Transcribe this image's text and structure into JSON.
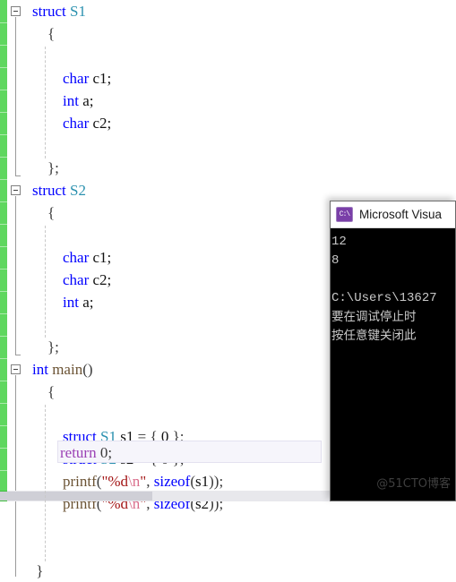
{
  "editor": {
    "change_bar_color": "#5fd75f",
    "current_line_highlight": "#f6f5fb",
    "colors": {
      "keyword": "#0000ff",
      "user_type": "#2b91af",
      "string": "#a31515",
      "escape": "#d96c8a",
      "return_keyword": "#9b41b5",
      "function": "#6b5334"
    },
    "lines": [
      {
        "fold": true,
        "indent": 0,
        "tokens": [
          {
            "t": "keyword",
            "v": "struct"
          },
          {
            "t": "plain",
            "v": " "
          },
          {
            "t": "type",
            "v": "S1"
          }
        ]
      },
      {
        "fold": false,
        "indent": 1,
        "tokens": [
          {
            "t": "pun",
            "v": "{"
          }
        ]
      },
      {
        "fold": false,
        "indent": 2,
        "tokens": []
      },
      {
        "fold": false,
        "indent": 2,
        "tokens": [
          {
            "t": "keyword",
            "v": "char"
          },
          {
            "t": "plain",
            "v": " "
          },
          {
            "t": "id",
            "v": "c1;"
          }
        ]
      },
      {
        "fold": false,
        "indent": 2,
        "tokens": [
          {
            "t": "keyword",
            "v": "int"
          },
          {
            "t": "plain",
            "v": " "
          },
          {
            "t": "id",
            "v": "a;"
          }
        ]
      },
      {
        "fold": false,
        "indent": 2,
        "tokens": [
          {
            "t": "keyword",
            "v": "char"
          },
          {
            "t": "plain",
            "v": " "
          },
          {
            "t": "id",
            "v": "c2;"
          }
        ]
      },
      {
        "fold": false,
        "indent": 2,
        "tokens": []
      },
      {
        "fold": false,
        "indent": 1,
        "tokens": [
          {
            "t": "pun",
            "v": "};"
          }
        ]
      },
      {
        "fold": true,
        "indent": 0,
        "tokens": [
          {
            "t": "keyword",
            "v": "struct"
          },
          {
            "t": "plain",
            "v": " "
          },
          {
            "t": "type",
            "v": "S2"
          }
        ]
      },
      {
        "fold": false,
        "indent": 1,
        "tokens": [
          {
            "t": "pun",
            "v": "{"
          }
        ]
      },
      {
        "fold": false,
        "indent": 2,
        "tokens": []
      },
      {
        "fold": false,
        "indent": 2,
        "tokens": [
          {
            "t": "keyword",
            "v": "char"
          },
          {
            "t": "plain",
            "v": " "
          },
          {
            "t": "id",
            "v": "c1;"
          }
        ]
      },
      {
        "fold": false,
        "indent": 2,
        "tokens": [
          {
            "t": "keyword",
            "v": "char"
          },
          {
            "t": "plain",
            "v": " "
          },
          {
            "t": "id",
            "v": "c2;"
          }
        ]
      },
      {
        "fold": false,
        "indent": 2,
        "tokens": [
          {
            "t": "keyword",
            "v": "int"
          },
          {
            "t": "plain",
            "v": " "
          },
          {
            "t": "id",
            "v": "a;"
          }
        ]
      },
      {
        "fold": false,
        "indent": 2,
        "tokens": []
      },
      {
        "fold": false,
        "indent": 1,
        "tokens": [
          {
            "t": "pun",
            "v": "};"
          }
        ]
      },
      {
        "fold": true,
        "indent": 0,
        "tokens": [
          {
            "t": "keyword",
            "v": "int"
          },
          {
            "t": "plain",
            "v": " "
          },
          {
            "t": "fn",
            "v": "main"
          },
          {
            "t": "pun",
            "v": "()"
          }
        ]
      },
      {
        "fold": false,
        "indent": 1,
        "tokens": [
          {
            "t": "pun",
            "v": "{"
          }
        ]
      },
      {
        "fold": false,
        "indent": 2,
        "tokens": []
      },
      {
        "fold": false,
        "indent": 2,
        "tokens": [
          {
            "t": "keyword",
            "v": "struct"
          },
          {
            "t": "plain",
            "v": " "
          },
          {
            "t": "type",
            "v": "S1"
          },
          {
            "t": "plain",
            "v": " "
          },
          {
            "t": "id",
            "v": "s1"
          },
          {
            "t": "pun",
            "v": " = { "
          },
          {
            "t": "num",
            "v": "0"
          },
          {
            "t": "pun",
            "v": " };"
          }
        ]
      },
      {
        "fold": false,
        "indent": 2,
        "tokens": [
          {
            "t": "keyword",
            "v": "struct"
          },
          {
            "t": "plain",
            "v": " "
          },
          {
            "t": "type",
            "v": "S2"
          },
          {
            "t": "plain",
            "v": " "
          },
          {
            "t": "id",
            "v": "s2"
          },
          {
            "t": "pun",
            "v": " = { "
          },
          {
            "t": "num",
            "v": "0"
          },
          {
            "t": "pun",
            "v": " };"
          }
        ]
      },
      {
        "fold": false,
        "indent": 2,
        "tokens": [
          {
            "t": "fn",
            "v": "printf"
          },
          {
            "t": "pun",
            "v": "("
          },
          {
            "t": "str",
            "v": "\"%d"
          },
          {
            "t": "esc",
            "v": "\\n"
          },
          {
            "t": "str",
            "v": "\""
          },
          {
            "t": "pun",
            "v": ", "
          },
          {
            "t": "keyword",
            "v": "sizeof"
          },
          {
            "t": "pun",
            "v": "("
          },
          {
            "t": "id",
            "v": "s1"
          },
          {
            "t": "pun",
            "v": "));"
          }
        ]
      },
      {
        "fold": false,
        "indent": 2,
        "tokens": [
          {
            "t": "fn",
            "v": "printf"
          },
          {
            "t": "pun",
            "v": "("
          },
          {
            "t": "str",
            "v": "\"%d"
          },
          {
            "t": "esc",
            "v": "\\n"
          },
          {
            "t": "str",
            "v": "\""
          },
          {
            "t": "pun",
            "v": ", "
          },
          {
            "t": "keyword",
            "v": "sizeof"
          },
          {
            "t": "pun",
            "v": "("
          },
          {
            "t": "id",
            "v": "s2"
          },
          {
            "t": "pun",
            "v": "));"
          }
        ]
      }
    ],
    "current_line_code": "return 0;",
    "current_line_keyword": "return",
    "current_line_rest": " 0;",
    "closing_brace": "}"
  },
  "console": {
    "title": "Microsoft Visua",
    "icon": "console-window-icon",
    "icon_glyph": "C:\\",
    "output_lines": [
      {
        "kind": "out",
        "text": "12"
      },
      {
        "kind": "out",
        "text": "8"
      },
      {
        "kind": "out",
        "text": ""
      },
      {
        "kind": "path",
        "text": "C:\\Users\\13627"
      },
      {
        "kind": "cn",
        "text": "要在调试停止时"
      },
      {
        "kind": "cn",
        "text": "按任意键关闭此"
      }
    ]
  },
  "watermark": {
    "text": "@51CTO博客"
  }
}
